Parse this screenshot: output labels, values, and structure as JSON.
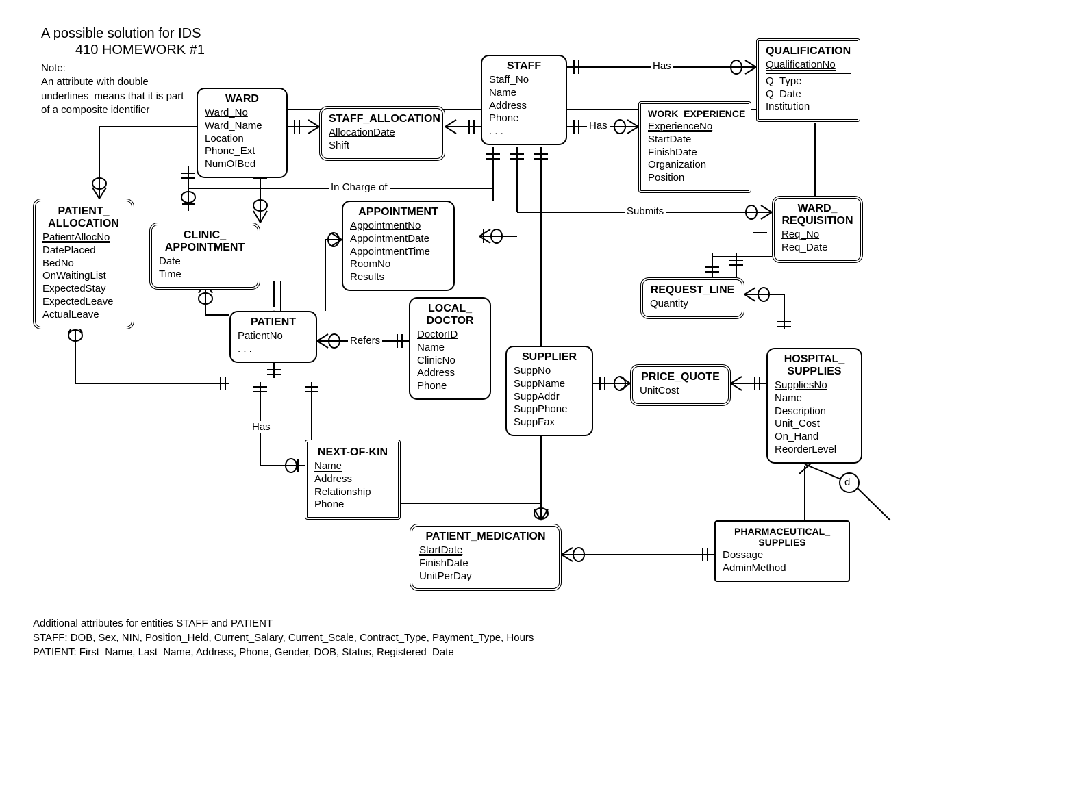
{
  "title": "A possible solution for IDS",
  "subtitle": "410 HOMEWORK #1",
  "note": "Note:\nAn attribute with double\nunderlines  means that it is part\nof a composite identifier",
  "entities": {
    "ward": {
      "name": "WARD",
      "attrs": "<span class='pk'>Ward_No</span><br>Ward_Name<br>Location<br>Phone_Ext<br>NumOfBed"
    },
    "staff": {
      "name": "STAFF",
      "attrs": "<span class='pk'>Staff_No</span><br>Name<br>Address<br>Phone<br>. . ."
    },
    "staff_allocation": {
      "name": "STAFF_ALLOCATION",
      "attrs": "<span class='du'>AllocationDate</span><br>Shift"
    },
    "qualification": {
      "name": "QUALIFICATION",
      "attrs": "<span class='du'>QualificationNo</span><br><hr style='border:none;border-top:1px solid #000;margin:2px 0'>Q_Type<br>Q_Date<br>Institution"
    },
    "work_experience": {
      "name": "WORK_EXPERIENCE",
      "attrs": "<span class='du'>ExperienceNo</span><br>StartDate<br>FinishDate<br>Organization<br>Position"
    },
    "patient_allocation": {
      "name": "PATIENT_\nALLOCATION",
      "attrs": "<span class='du'>PatientAllocNo</span><br>DatePlaced<br>BedNo<br>OnWaitingList<br>ExpectedStay<br>ExpectedLeave<br>ActualLeave"
    },
    "clinic_appointment": {
      "name": "CLINIC_\nAPPOINTMENT",
      "attrs": "Date<br>Time"
    },
    "appointment": {
      "name": "APPOINTMENT",
      "attrs": "<span class='pk'>AppointmentNo</span><br>AppointmentDate<br>AppointmentTime<br>RoomNo<br>Results"
    },
    "ward_requisition": {
      "name": "WARD_\nREQUISITION",
      "attrs": "<span class='du'>Req_No</span><br>Req_Date"
    },
    "patient": {
      "name": "PATIENT",
      "attrs": "<span class='pk'>PatientNo</span><br>. . ."
    },
    "local_doctor": {
      "name": "LOCAL_\nDOCTOR",
      "attrs": "<span class='pk'>DoctorID</span><br>Name<br>ClinicNo<br>Address<br>Phone"
    },
    "supplier": {
      "name": "SUPPLIER",
      "attrs": "<span class='pk'>SuppNo</span><br>SuppName<br>SuppAddr<br>SuppPhone<br>SuppFax"
    },
    "request_line": {
      "name": "REQUEST_LINE",
      "attrs": "Quantity"
    },
    "price_quote": {
      "name": "PRICE_QUOTE",
      "attrs": "UnitCost"
    },
    "hospital_supplies": {
      "name": "HOSPITAL_\nSUPPLIES",
      "attrs": "<span class='pk'>SuppliesNo</span><br>Name<br>Description<br>Unit_Cost<br>On_Hand<br>ReorderLevel"
    },
    "next_of_kin": {
      "name": "NEXT-OF-KIN",
      "attrs": "<span class='du'>Name</span><br>Address<br>Relationship<br>Phone"
    },
    "patient_medication": {
      "name": "PATIENT_MEDICATION",
      "attrs": "<span class='du'>StartDate</span><br>FinishDate<br>UnitPerDay"
    },
    "pharmaceutical_supplies": {
      "name": "PHARMACEUTICAL_\nSUPPLIES",
      "attrs": "Dossage<br>AdminMethod"
    }
  },
  "labels": {
    "in_charge_of": "In Charge of",
    "has1": "Has",
    "has2": "Has",
    "has3": "Has",
    "submits": "Submits",
    "refers": "Refers",
    "d": "d"
  },
  "footer": {
    "line1": "Additional attributes for entities STAFF and PATIENT",
    "line2": "STAFF: DOB, Sex, NIN, Position_Held, Current_Salary, Current_Scale, Contract_Type, Payment_Type, Hours",
    "line3": "PATIENT: First_Name, Last_Name, Address, Phone, Gender, DOB, Status, Registered_Date"
  }
}
